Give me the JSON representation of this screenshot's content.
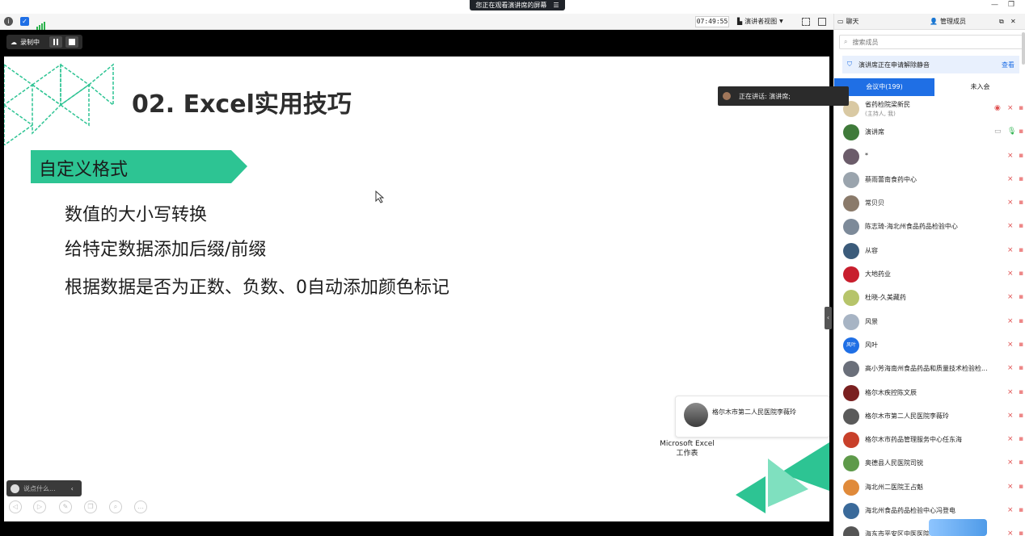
{
  "share_banner": {
    "text": "您正在观看演讲席的屏幕",
    "menu_icon": "menu-icon"
  },
  "toolbar": {
    "time": "07:49:55",
    "view_label": "演讲者视图"
  },
  "recording": {
    "label": "录制中"
  },
  "slide": {
    "title": "02. Excel实用技巧",
    "section": "自定义格式",
    "bullets": [
      "数值的大小写转换",
      "给特定数据添加后缀/前缀",
      "根据数据是否为正数、负数、0自动添加颜色标记"
    ],
    "popup_name": "格尔木市第二人民医院李薇玲",
    "excel_line1": "Microsoft Excel",
    "excel_line2": "工作表",
    "accent": "#2dc493"
  },
  "chat_input": {
    "placeholder": "说点什么..."
  },
  "speaking": {
    "label": "正在讲话: 演讲席;"
  },
  "panel": {
    "tab_chat": "聊天",
    "tab_members": "管理成员",
    "search_placeholder": "搜索成员",
    "notice_text": "演讲席正在申请解除静音",
    "notice_action": "查看",
    "tab_in_meeting": "会议中(199)",
    "tab_not_joined": "未入会"
  },
  "members": [
    {
      "name": "省药检院梁新民",
      "sub": "(主持人, 我)",
      "color": "#d9c9a3"
    },
    {
      "name": "演讲席",
      "color": "#3f7a3a"
    },
    {
      "name": "*",
      "color": "#6b5c6a"
    },
    {
      "name": "蔡雨蕾南食药中心",
      "color": "#9aa4ad"
    },
    {
      "name": "常贝贝",
      "color": "#8a7a6a"
    },
    {
      "name": "陈志琦-海北州食品药品检验中心",
      "color": "#7d8a99"
    },
    {
      "name": "从容",
      "color": "#3b5b7a"
    },
    {
      "name": "大地药业",
      "color": "#c81e2d"
    },
    {
      "name": "杜晓-久美藏药",
      "color": "#b6c46a"
    },
    {
      "name": "风景",
      "color": "#a7b4c4"
    },
    {
      "name": "风叶",
      "avatar_text": "风叶",
      "color": "#1f6fe5"
    },
    {
      "name": "高小芳海南州食品药品和质量技术检验检...",
      "color": "#6a6f7a"
    },
    {
      "name": "格尔木疾控陈文辰",
      "color": "#7a2020"
    },
    {
      "name": "格尔木市第二人民医院李薇玲",
      "color": "#5a5a5a"
    },
    {
      "name": "格尔木市药品管理服务中心任东海",
      "color": "#c8402a"
    },
    {
      "name": "奥德县人民医院司锐",
      "color": "#5e9a4a"
    },
    {
      "name": "海北州二医院王占魁",
      "color": "#e08a3a"
    },
    {
      "name": "海北州食品药品检验中心冯登电",
      "color": "#3a6a9a"
    },
    {
      "name": "海东市平安区中医医院",
      "color": "#555555"
    }
  ]
}
